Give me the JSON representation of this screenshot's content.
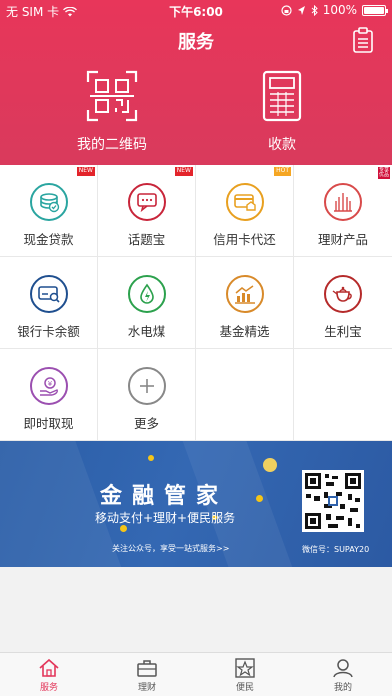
{
  "status_bar": {
    "carrier": "无 SIM 卡",
    "time": "下午6:00",
    "battery": "100%",
    "battery_level": 100
  },
  "header": {
    "title": "服务",
    "qr_label": "我的二维码",
    "pay_label": "收款"
  },
  "grid": {
    "items": [
      {
        "label": "现金贷款",
        "icon": "cash-loan-icon",
        "color": "#2aa5a0",
        "badge": "NEW"
      },
      {
        "label": "话题宝",
        "icon": "chat-icon",
        "color": "#c8253a",
        "badge": "NEW"
      },
      {
        "label": "信用卡代还",
        "icon": "credit-card-icon",
        "color": "#e8a020",
        "badge": "HOT"
      },
      {
        "label": "理财产品",
        "icon": "finance-building-icon",
        "color": "#d84a4a",
        "badge": "专享优品"
      },
      {
        "label": "银行卡余额",
        "icon": "bank-card-icon",
        "color": "#1f4f8f",
        "badge": ""
      },
      {
        "label": "水电煤",
        "icon": "utility-icon",
        "color": "#2ca14d",
        "badge": ""
      },
      {
        "label": "基金精选",
        "icon": "fund-chart-icon",
        "color": "#d88a2a",
        "badge": ""
      },
      {
        "label": "生利宝",
        "icon": "teapot-icon",
        "color": "#b52a2a",
        "badge": ""
      },
      {
        "label": "即时取现",
        "icon": "instant-cash-icon",
        "color": "#9b4fb0",
        "badge": ""
      },
      {
        "label": "更多",
        "icon": "plus-icon",
        "color": "#888888",
        "badge": ""
      }
    ]
  },
  "banner": {
    "title": "金融管家",
    "subtitle": "移动支付+理财+便民服务",
    "note": "关注公众号，享受一站式服务>>",
    "wechat": "微信号：SUPAY20"
  },
  "tabs": [
    {
      "label": "服务",
      "icon": "home-icon",
      "active": true
    },
    {
      "label": "理财",
      "icon": "briefcase-icon",
      "active": false
    },
    {
      "label": "便民",
      "icon": "star-icon",
      "active": false
    },
    {
      "label": "我的",
      "icon": "user-icon",
      "active": false
    }
  ],
  "colors": {
    "brand": "#e3365a",
    "banner": "#2f62ad"
  }
}
